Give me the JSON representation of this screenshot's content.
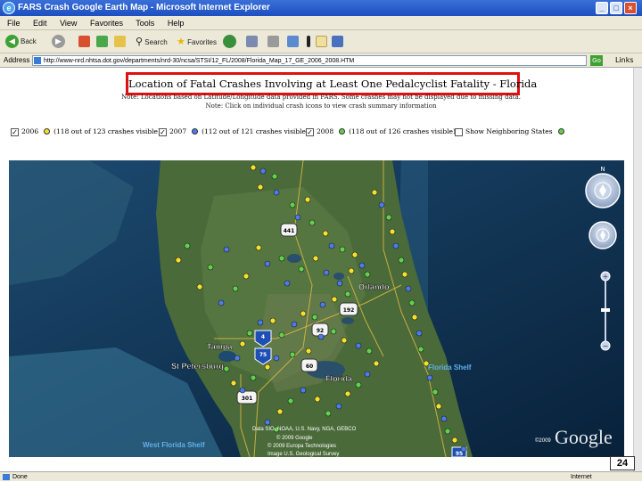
{
  "window": {
    "title": "FARS Crash Google Earth Map - Microsoft Internet Explorer",
    "controls": [
      "_",
      "□",
      "×"
    ]
  },
  "menu": [
    "File",
    "Edit",
    "View",
    "Favorites",
    "Tools",
    "Help"
  ],
  "toolbar": {
    "back": "Back",
    "search": "Search",
    "favorites": "Favorites"
  },
  "address": {
    "label": "Address",
    "url": "http://www-nrd.nhtsa.dot.gov/departments/nrd-30/ncsa/STSI/12_FL/2008/Florida_Map_17_GE_2006_2008.HTM",
    "go": "Go",
    "links": "Links"
  },
  "page": {
    "title": "Location of Fatal Crashes Involving at Least One Pedalcyclist Fatality - Florida",
    "description": "Note: Locations based on Latitude/Longitude data provided in FARS. Some crashes may not be displayed due to missing data.",
    "note": "Note: Click on individual crash icons to view crash summary information",
    "checkboxes": [
      {
        "label": "2006",
        "visible": "(118 out of 123 crashes visible)",
        "checked": true,
        "color": "#f5e12c"
      },
      {
        "label": "2007",
        "visible": "(112 out of 121 crashes visible)",
        "checked": true,
        "color": "#4a7cf0"
      },
      {
        "label": "2008",
        "visible": "(118 out of 126 crashes visible)",
        "checked": true,
        "color": "#5fd24a"
      },
      {
        "label": "Show Neighboring States",
        "visible": "",
        "checked": false,
        "color": "#5fd24a"
      }
    ]
  },
  "map": {
    "labels": {
      "orlando": "Orlando",
      "tampa": "Tampa",
      "st_petersburg": "St Petersburg",
      "florida": "Florida",
      "east_shelf": "Florida Shelf",
      "west_shelf": "West Florida Shelf"
    },
    "shields": [
      "441",
      "192",
      "92",
      "4",
      "75",
      "60",
      "301",
      "95"
    ],
    "compass": "N",
    "attribution": [
      "Data SIO, NOAA, U.S. Navy, NGA, GEBCO",
      "© 2009 Google",
      "© 2009 Europa Technologies",
      "Image U.S. Geological Survey"
    ],
    "copyright": "©2009",
    "google": "Google"
  },
  "status": {
    "text": "Done",
    "zone": "Internet"
  },
  "slide_number": "24"
}
